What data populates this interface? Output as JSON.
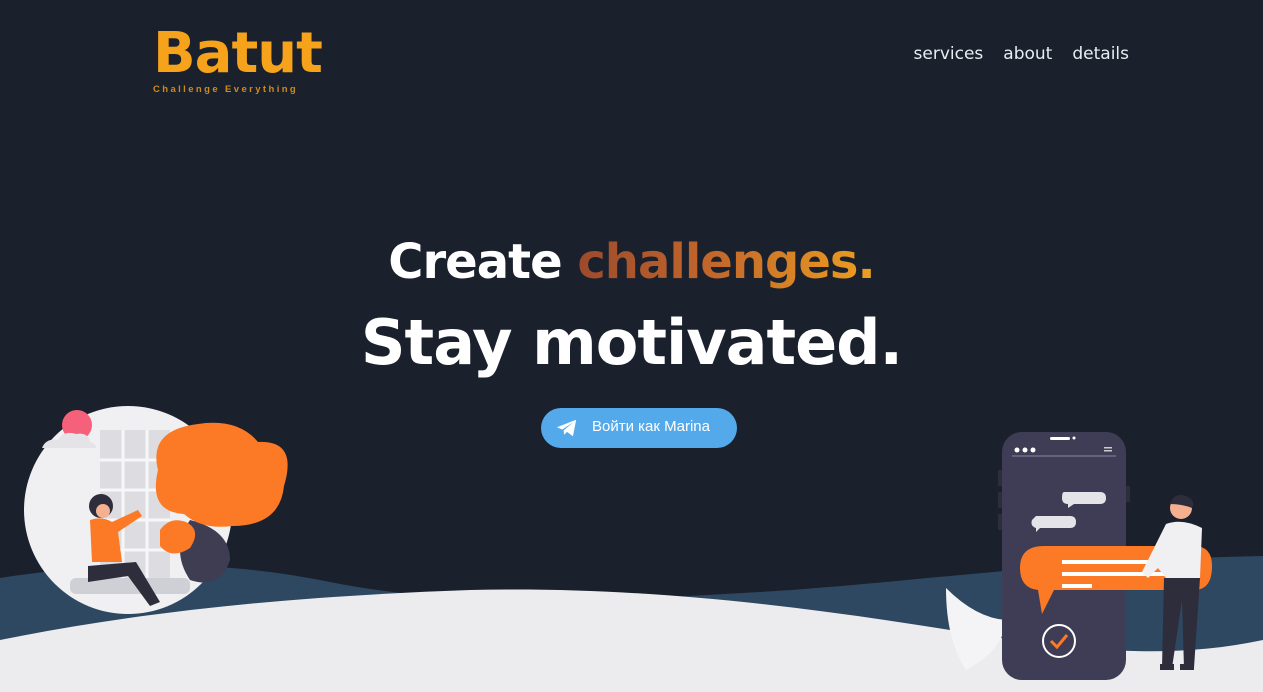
{
  "header": {
    "logo_title": "Batut",
    "logo_subtitle": "Challenge Everything",
    "nav": [
      {
        "label": "services"
      },
      {
        "label": "about"
      },
      {
        "label": "details"
      }
    ]
  },
  "hero": {
    "line1_plain": "Create",
    "line1_highlight": "challenges.",
    "line2": "Stay motivated."
  },
  "telegram_button": {
    "label": "Войти как Marina",
    "icon": "telegram-icon"
  },
  "colors": {
    "background": "#1a212d",
    "accent": "#f6a31b",
    "telegram": "#54a9eb",
    "illustration_orange": "#fc7a25"
  }
}
